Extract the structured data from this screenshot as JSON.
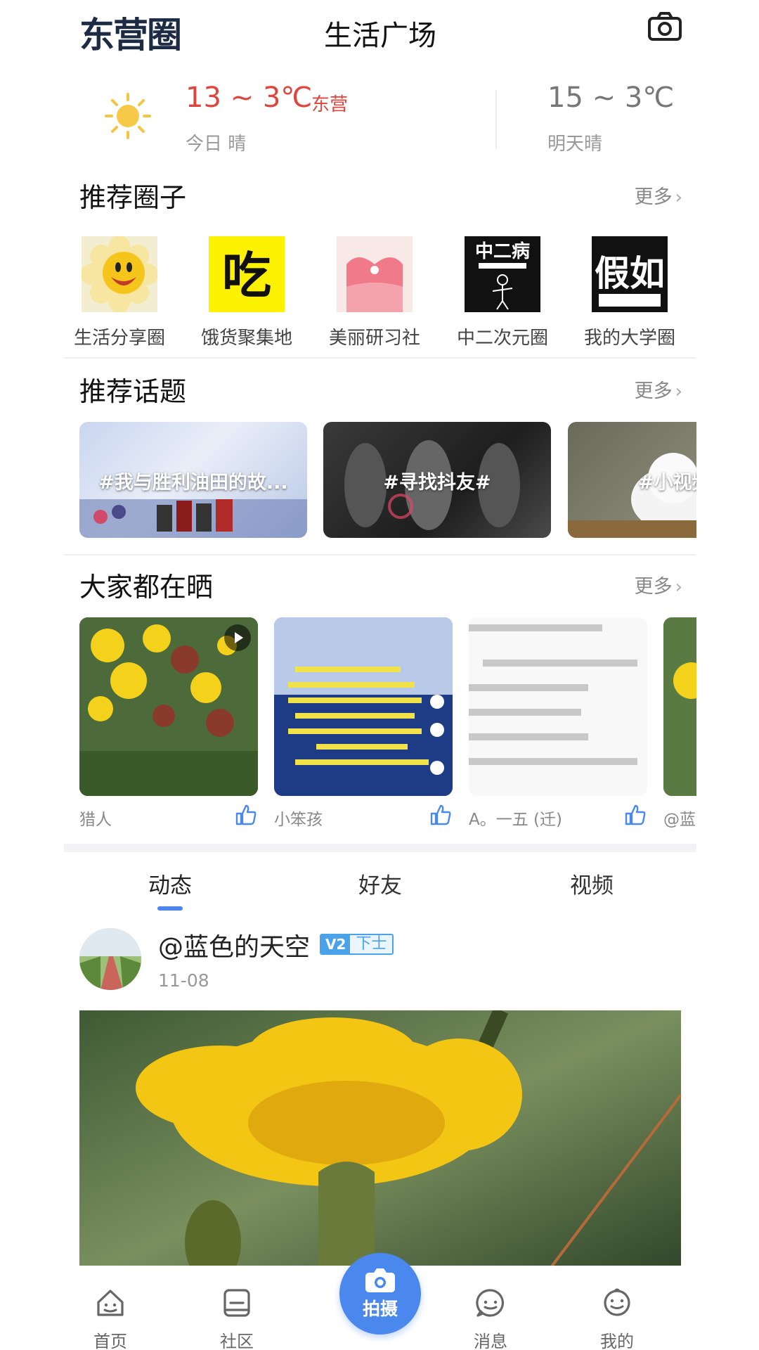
{
  "header": {
    "logo": "东营圈",
    "title": "生活广场",
    "camera_icon": "camera-icon"
  },
  "weather": {
    "today_temp": "13 ~ 3℃",
    "city": "东营",
    "today_desc": "今日 晴",
    "tomorrow_temp": "15 ~ 3℃",
    "tomorrow_desc": "明天晴",
    "icon": "sun-icon"
  },
  "circles_section": {
    "title": "推荐圈子",
    "more": "更多",
    "items": [
      {
        "label": "生活分享圈",
        "thumb_text": ""
      },
      {
        "label": "饿货聚集地",
        "thumb_text": "吃"
      },
      {
        "label": "美丽研习社",
        "thumb_text": ""
      },
      {
        "label": "中二次元圈",
        "thumb_text": "中二病"
      },
      {
        "label": "我的大学圈",
        "thumb_text": "假如"
      }
    ]
  },
  "topics_section": {
    "title": "推荐话题",
    "more": "更多",
    "items": [
      {
        "label": "#我与胜利油田的故..."
      },
      {
        "label": "#寻找抖友#"
      },
      {
        "label": "#小视频"
      }
    ]
  },
  "shares_section": {
    "title": "大家都在晒",
    "more": "更多",
    "items": [
      {
        "user": "猎人"
      },
      {
        "user": "小笨孩"
      },
      {
        "user": "A。一五 (迁)"
      },
      {
        "user": "@蓝色的天空"
      }
    ]
  },
  "feed_tabs": {
    "items": [
      "动态",
      "好友",
      "视频"
    ],
    "active": "动态"
  },
  "post": {
    "user": "@蓝色的天空",
    "level": "V2",
    "rank": "下士",
    "date": "11-08"
  },
  "bottom_nav": {
    "home": "首页",
    "community": "社区",
    "shoot": "拍摄",
    "messages": "消息",
    "mine": "我的"
  },
  "colors": {
    "accent": "#4a88ee",
    "temp_today": "#e0453d",
    "logo": "#1e2b45"
  }
}
